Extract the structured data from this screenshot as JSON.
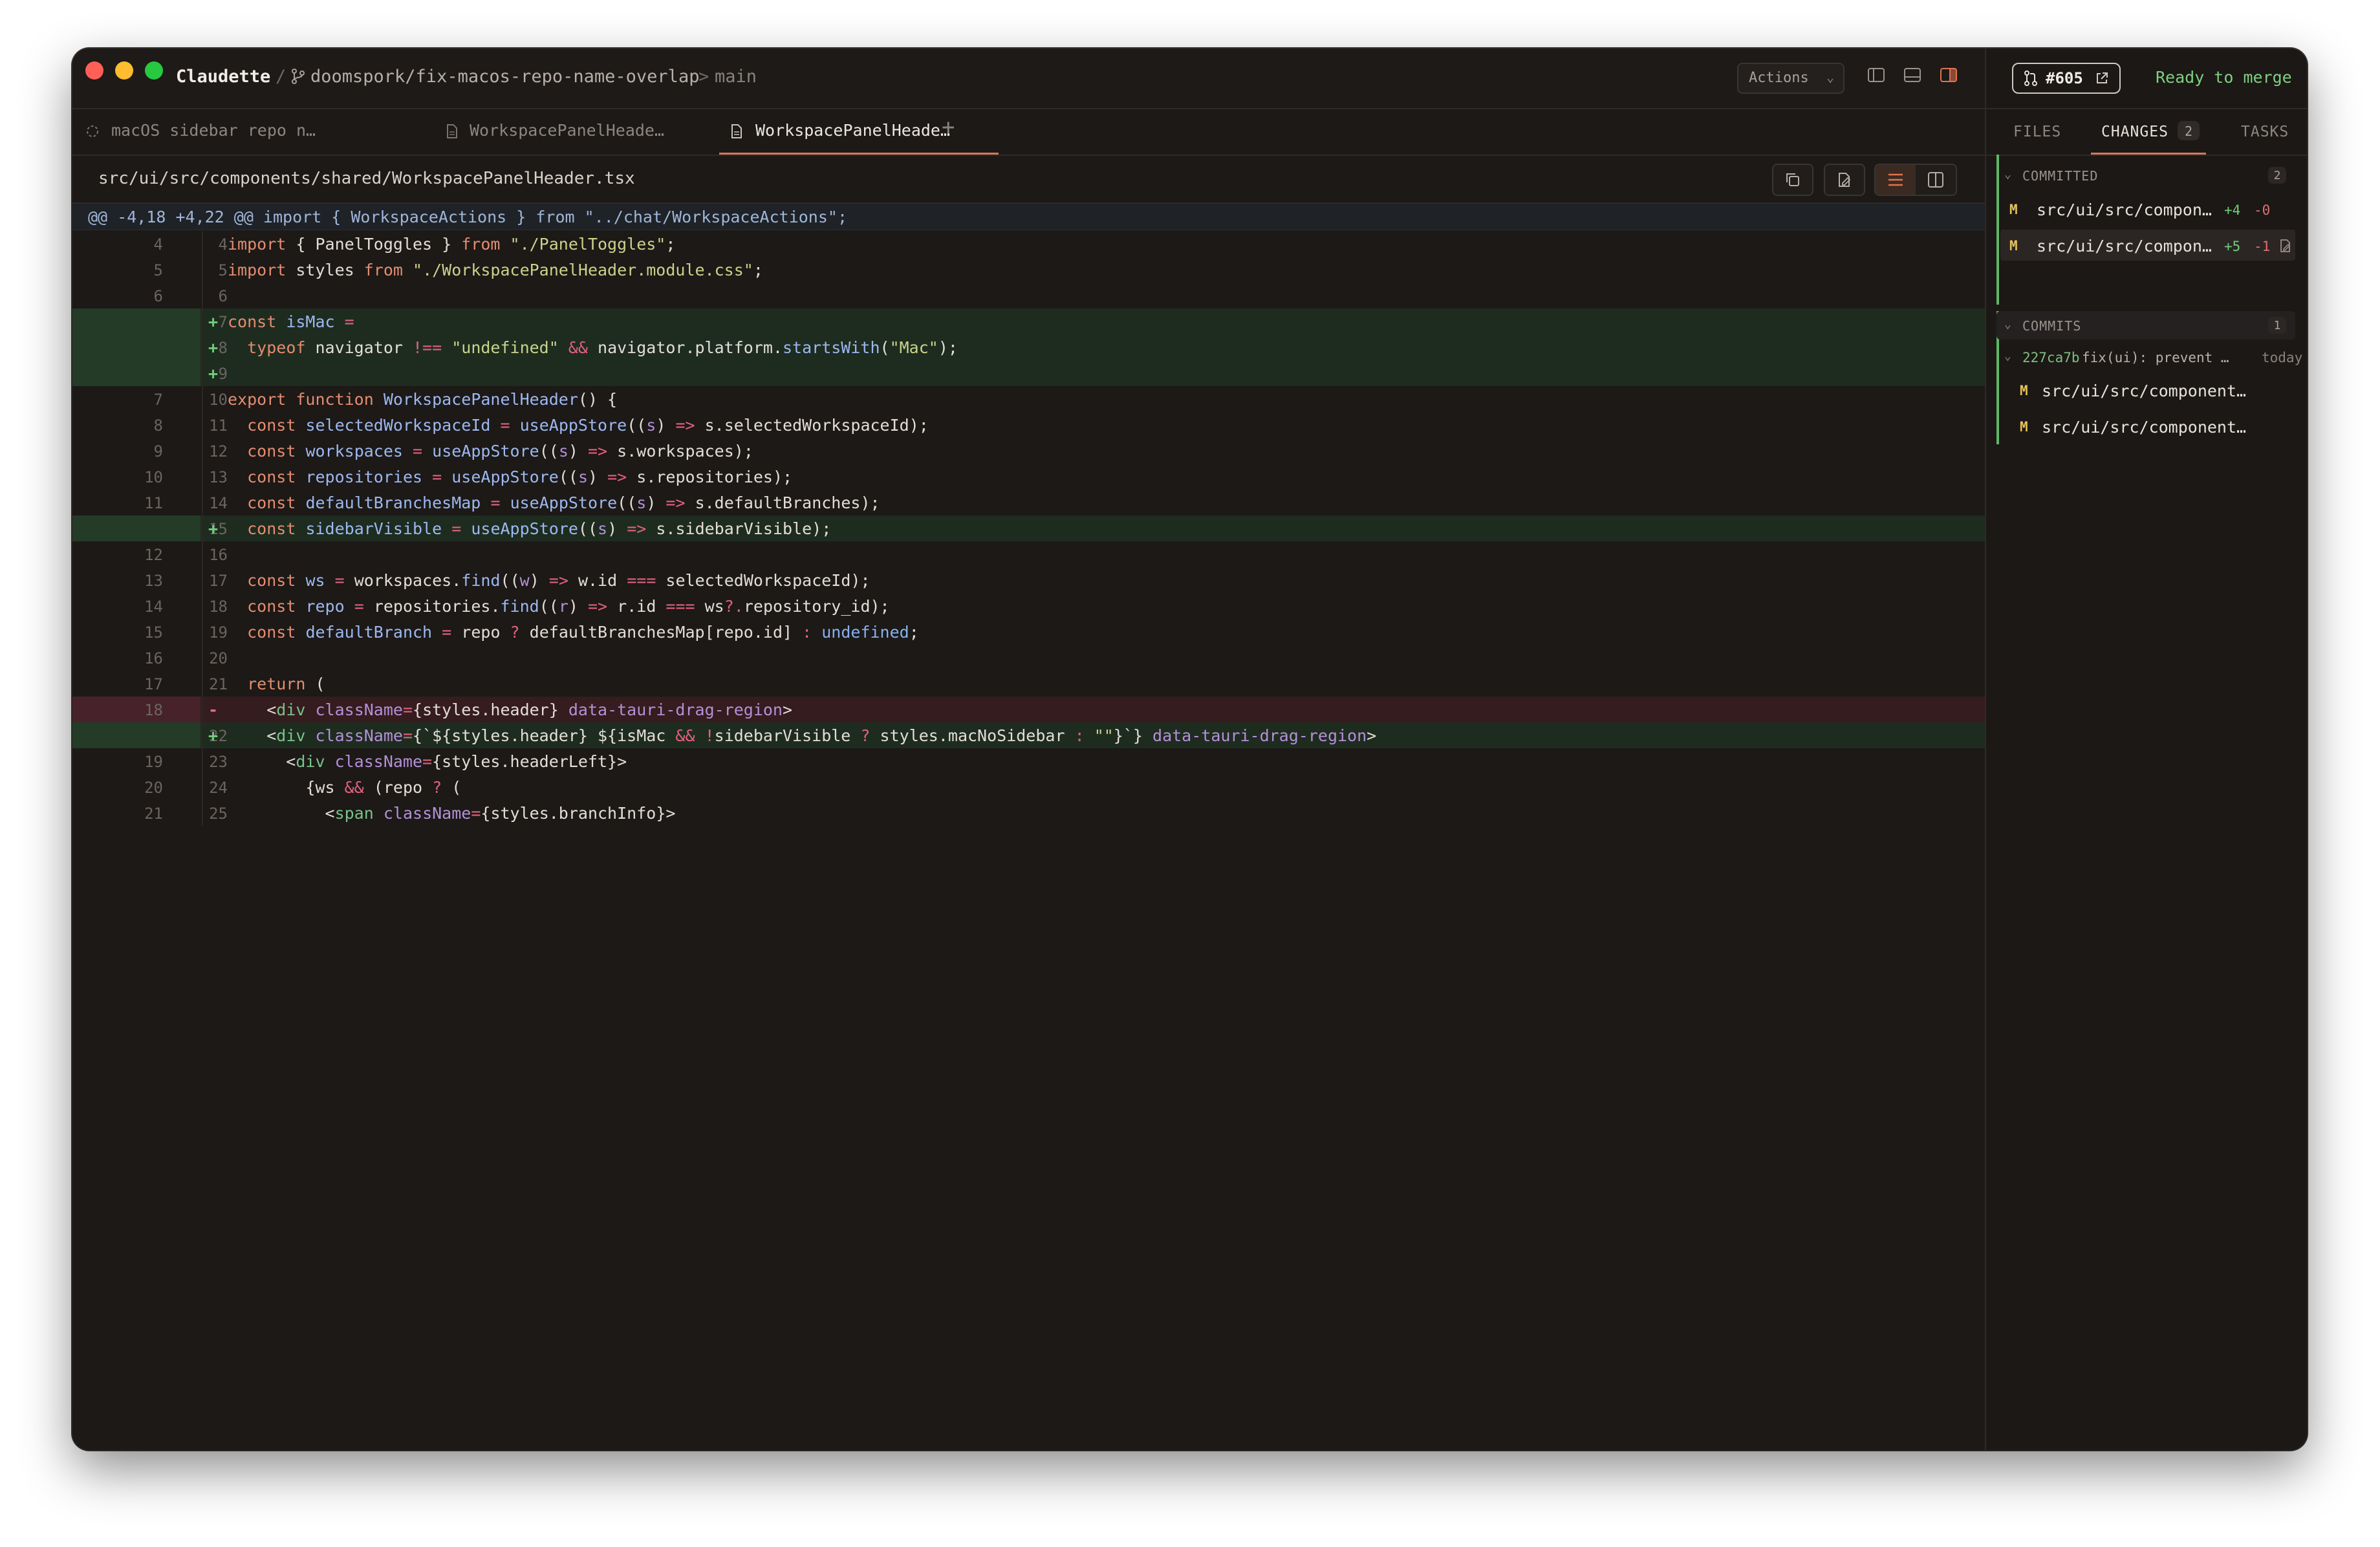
{
  "window": {
    "app_name": "Claudette",
    "branch": "doomspork/fix-macos-repo-name-overlap",
    "base_branch": "main",
    "breadcrumb_sep": "/",
    "base_sep": ">"
  },
  "toolbar": {
    "actions_label": "Actions"
  },
  "tabs": [
    {
      "label": "macOS sidebar repo n…",
      "icon": "spinner-icon",
      "active": false
    },
    {
      "label": "WorkspacePanelHeade…",
      "icon": "file-icon",
      "active": false
    },
    {
      "label": "WorkspacePanelHeade…",
      "icon": "file-icon",
      "active": true
    }
  ],
  "tab_add": "+",
  "file_path": "src/ui/src/components/shared/WorkspacePanelHeader.tsx",
  "hunk_header": "@@ -4,18 +4,22 @@ import { WorkspaceActions } from \"../chat/WorkspaceActions\";",
  "diff": [
    {
      "old": "4",
      "new": "4",
      "type": "ctx",
      "marker": ""
    },
    {
      "old": "5",
      "new": "5",
      "type": "ctx",
      "marker": ""
    },
    {
      "old": "6",
      "new": "6",
      "type": "ctx",
      "marker": ""
    },
    {
      "old": "",
      "new": "7",
      "type": "add",
      "marker": "+"
    },
    {
      "old": "",
      "new": "8",
      "type": "add",
      "marker": "+"
    },
    {
      "old": "",
      "new": "9",
      "type": "add",
      "marker": "+"
    },
    {
      "old": "7",
      "new": "10",
      "type": "ctx",
      "marker": ""
    },
    {
      "old": "8",
      "new": "11",
      "type": "ctx",
      "marker": ""
    },
    {
      "old": "9",
      "new": "12",
      "type": "ctx",
      "marker": ""
    },
    {
      "old": "10",
      "new": "13",
      "type": "ctx",
      "marker": ""
    },
    {
      "old": "11",
      "new": "14",
      "type": "ctx",
      "marker": ""
    },
    {
      "old": "",
      "new": "15",
      "type": "add",
      "marker": "+"
    },
    {
      "old": "12",
      "new": "16",
      "type": "ctx",
      "marker": ""
    },
    {
      "old": "13",
      "new": "17",
      "type": "ctx",
      "marker": ""
    },
    {
      "old": "14",
      "new": "18",
      "type": "ctx",
      "marker": ""
    },
    {
      "old": "15",
      "new": "19",
      "type": "ctx",
      "marker": ""
    },
    {
      "old": "16",
      "new": "20",
      "type": "ctx",
      "marker": ""
    },
    {
      "old": "17",
      "new": "21",
      "type": "ctx",
      "marker": ""
    },
    {
      "old": "18",
      "new": "",
      "type": "del",
      "marker": "-"
    },
    {
      "old": "",
      "new": "22",
      "type": "add",
      "marker": "+"
    },
    {
      "old": "19",
      "new": "23",
      "type": "ctx",
      "marker": ""
    },
    {
      "old": "20",
      "new": "24",
      "type": "ctx",
      "marker": ""
    },
    {
      "old": "21",
      "new": "25",
      "type": "ctx",
      "marker": ""
    }
  ],
  "code": {
    "l0": [
      "import",
      " { PanelToggles } ",
      "from",
      " ",
      "\"./PanelToggles\"",
      ";"
    ],
    "l1": [
      "import",
      " styles ",
      "from",
      " ",
      "\"./WorkspacePanelHeader.module.css\"",
      ";"
    ],
    "l3": [
      "const",
      " ",
      "isMac",
      " ",
      "="
    ],
    "l4": [
      "  ",
      "typeof",
      " navigator ",
      "!==",
      " ",
      "\"undefined\"",
      " ",
      "&&",
      " navigator.platform.",
      "startsWith",
      "(",
      "\"Mac\"",
      ");"
    ],
    "l6": [
      "export",
      " ",
      "function",
      " ",
      "WorkspacePanelHeader",
      "() {"
    ],
    "l7": [
      "  ",
      "const",
      " ",
      "selectedWorkspaceId",
      " ",
      "=",
      " ",
      "useAppStore",
      "((",
      "s",
      ") ",
      "=>",
      " s.selectedWorkspaceId);"
    ],
    "l8": [
      "  ",
      "const",
      " ",
      "workspaces",
      " ",
      "=",
      " ",
      "useAppStore",
      "((",
      "s",
      ") ",
      "=>",
      " s.workspaces);"
    ],
    "l9": [
      "  ",
      "const",
      " ",
      "repositories",
      " ",
      "=",
      " ",
      "useAppStore",
      "((",
      "s",
      ") ",
      "=>",
      " s.repositories);"
    ],
    "l10": [
      "  ",
      "const",
      " ",
      "defaultBranchesMap",
      " ",
      "=",
      " ",
      "useAppStore",
      "((",
      "s",
      ") ",
      "=>",
      " s.defaultBranches);"
    ],
    "l11": [
      "  ",
      "const",
      " ",
      "sidebarVisible",
      " ",
      "=",
      " ",
      "useAppStore",
      "((",
      "s",
      ") ",
      "=>",
      " s.sidebarVisible);"
    ],
    "l13": [
      "  ",
      "const",
      " ",
      "ws",
      " ",
      "=",
      " workspaces.",
      "find",
      "((",
      "w",
      ") ",
      "=>",
      " w.id ",
      "===",
      " selectedWorkspaceId);"
    ],
    "l14": [
      "  ",
      "const",
      " ",
      "repo",
      " ",
      "=",
      " repositories.",
      "find",
      "((",
      "r",
      ") ",
      "=>",
      " r.id ",
      "===",
      " ws",
      "?.",
      "repository_id);"
    ],
    "l15": [
      "  ",
      "const",
      " ",
      "defaultBranch",
      " ",
      "=",
      " repo ",
      "?",
      " defaultBranchesMap[repo.id] ",
      ":",
      " ",
      "undefined",
      ";"
    ],
    "l17": [
      "  ",
      "return",
      " ("
    ],
    "l18": [
      "    <",
      "div",
      " ",
      "className",
      "=",
      "{styles.header}",
      " ",
      "data-tauri-drag-region",
      ">"
    ],
    "l19": [
      "    <",
      "div",
      " ",
      "className",
      "=",
      "{`${styles.header} ${isMac ",
      "&&",
      " ",
      "!",
      "sidebarVisible ",
      "?",
      " styles.macNoSidebar ",
      ":",
      " ",
      "\"\"",
      "}`}",
      " ",
      "data-tauri-drag-region",
      ">"
    ],
    "l20": [
      "      <",
      "div",
      " ",
      "className",
      "=",
      "{styles.headerLeft}",
      ">"
    ],
    "l21": [
      "        {ws ",
      "&&",
      " (repo ",
      "?",
      " ("
    ],
    "l22": [
      "          <",
      "span",
      " ",
      "className",
      "=",
      "{styles.branchInfo}",
      ">"
    ]
  },
  "pr": {
    "number": "#605",
    "status": "Ready to merge"
  },
  "right_tabs": [
    {
      "label": "FILES",
      "active": false
    },
    {
      "label": "CHANGES",
      "active": true,
      "count": "2"
    },
    {
      "label": "TASKS",
      "active": false
    }
  ],
  "committed": {
    "label": "COMMITTED",
    "count": "2",
    "files": [
      {
        "status": "M",
        "name": "src/ui/src/compon…",
        "plus": "+4",
        "minus": "-0"
      },
      {
        "status": "M",
        "name": "src/ui/src/compon…",
        "plus": "+5",
        "minus": "-1"
      }
    ]
  },
  "commits": {
    "label": "COMMITS",
    "count": "1",
    "entry": {
      "sha": "227ca7b",
      "message": "fix(ui): prevent …",
      "when": "today"
    },
    "files": [
      {
        "status": "M",
        "name": "src/ui/src/component…"
      },
      {
        "status": "M",
        "name": "src/ui/src/component…"
      }
    ]
  },
  "colors": {
    "accent": "#d9775a",
    "add_bg": "#1e2c20",
    "del_bg": "#351c1e",
    "ready": "#7fd07f",
    "modified": "#e7c25a"
  }
}
